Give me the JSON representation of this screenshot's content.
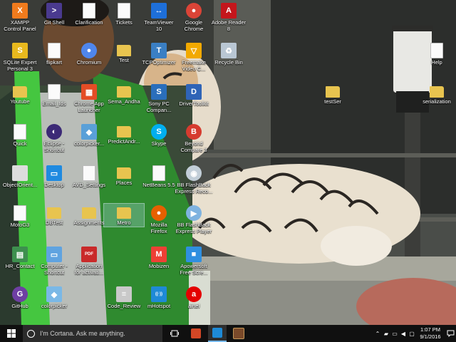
{
  "desktop": {
    "icons": [
      {
        "label": "XAMPP\nControl Panel",
        "icon": "xampp-icon",
        "color": "#f07b1d",
        "glyph": "X",
        "kind": "glyph"
      },
      {
        "label": "Git Shell",
        "icon": "git-shell-icon",
        "color": "#4a3a8f",
        "glyph": ">",
        "kind": "glyph"
      },
      {
        "label": "Clarification",
        "icon": "document-icon",
        "kind": "doc"
      },
      {
        "label": "Tickets",
        "icon": "document-icon",
        "kind": "doc"
      },
      {
        "label": "TeamViewer\n10",
        "icon": "teamviewer-icon",
        "color": "#1e6fd9",
        "glyph": "↔",
        "kind": "glyph"
      },
      {
        "label": "Google\nChrome",
        "icon": "chrome-icon",
        "color": "#db4437",
        "glyph": "●",
        "kind": "round"
      },
      {
        "label": "Adobe Reader\n8",
        "icon": "adobe-reader-icon",
        "color": "#c4161c",
        "glyph": "A",
        "kind": "glyph"
      },
      {
        "label": "SQLite Expert\nPersonal 3",
        "icon": "sqlite-icon",
        "color": "#e8b91e",
        "glyph": "S",
        "kind": "glyph"
      },
      {
        "label": "flipkart",
        "icon": "document-icon",
        "kind": "doc"
      },
      {
        "label": "Chromium",
        "icon": "chromium-icon",
        "color": "#4f86ec",
        "glyph": "●",
        "kind": "round"
      },
      {
        "label": "Test",
        "icon": "folder-icon",
        "kind": "folder"
      },
      {
        "label": "TCPOptimizer",
        "icon": "tcpoptimizer-icon",
        "color": "#3a7fc4",
        "glyph": "T",
        "kind": "glyph"
      },
      {
        "label": "Freemake\nVideo C...",
        "icon": "freemake-icon",
        "color": "#f2a900",
        "glyph": "▽",
        "kind": "glyph"
      },
      {
        "label": "Recycle Bin",
        "icon": "recycle-bin-icon",
        "color": "#b9c7d4",
        "glyph": "♻",
        "kind": "glyph"
      },
      {
        "label": "Help",
        "icon": "document-icon",
        "kind": "doc"
      },
      {
        "label": "Youtube",
        "icon": "folder-icon",
        "kind": "folder"
      },
      {
        "label": "Email_Ids",
        "icon": "document-icon",
        "kind": "doc"
      },
      {
        "label": "Chrome App\nLauncher",
        "icon": "chrome-app-launcher-icon",
        "color": "#e44d26",
        "glyph": "▦",
        "kind": "glyph"
      },
      {
        "label": "Sema_Andha",
        "icon": "folder-icon",
        "kind": "folder"
      },
      {
        "label": "Sony PC\nCompan...",
        "icon": "sony-pc-companion-icon",
        "color": "#2a6ebb",
        "glyph": "S",
        "kind": "glyph"
      },
      {
        "label": "DriverToolkit",
        "icon": "drivertoolkit-icon",
        "color": "#2f64b7",
        "glyph": "D",
        "kind": "glyph"
      },
      {
        "label": "testSer",
        "icon": "folder-icon",
        "kind": "folder"
      },
      {
        "label": "serialization",
        "icon": "folder-icon",
        "kind": "folder"
      },
      {
        "label": "Quick",
        "icon": "document-icon",
        "kind": "doc"
      },
      {
        "label": "Eclipse -\nShortcut",
        "icon": "eclipse-icon",
        "color": "#3c2a76",
        "glyph": "◐",
        "kind": "round"
      },
      {
        "label": "colorpicker...",
        "icon": "colorpicker-icon",
        "color": "#5aa0d8",
        "glyph": "◆",
        "kind": "glyph"
      },
      {
        "label": "PredictAndr...",
        "icon": "folder-icon",
        "kind": "folder"
      },
      {
        "label": "Skype",
        "icon": "skype-icon",
        "color": "#00aff0",
        "glyph": "S",
        "kind": "round"
      },
      {
        "label": "Beyond\nCompare 3",
        "icon": "beyond-compare-icon",
        "color": "#d63b2f",
        "glyph": "B",
        "kind": "round"
      },
      {
        "label": "ObjectOrient...",
        "icon": "object-orient-icon",
        "color": "#dcdcdc",
        "glyph": "",
        "kind": "glyph"
      },
      {
        "label": "Desktop",
        "icon": "desktop-shortcut-icon",
        "color": "#1f8ae0",
        "glyph": "▭",
        "kind": "glyph"
      },
      {
        "label": "AVD_Settings",
        "icon": "document-icon",
        "kind": "doc"
      },
      {
        "label": "Places",
        "icon": "folder-icon",
        "kind": "folder"
      },
      {
        "label": "NetBeans 5.5",
        "icon": "document-icon",
        "kind": "doc"
      },
      {
        "label": "BB FlashBack\nExpress Reco...",
        "icon": "bb-flashback-recorder-icon",
        "color": "#c2ced8",
        "glyph": "◉",
        "kind": "round"
      },
      {
        "label": "MotoG3",
        "icon": "document-icon",
        "kind": "doc"
      },
      {
        "label": "DBTest",
        "icon": "folder-icon",
        "kind": "folder"
      },
      {
        "label": "Assignments",
        "icon": "folder-icon",
        "kind": "folder"
      },
      {
        "label": "Metro",
        "icon": "folder-icon",
        "kind": "folder"
      },
      {
        "label": "Mozilla\nFirefox",
        "icon": "firefox-icon",
        "color": "#e66000",
        "glyph": "●",
        "kind": "round"
      },
      {
        "label": "BB FlashBack\nExpress Player",
        "icon": "bb-flashback-player-icon",
        "color": "#7fb3e0",
        "glyph": "▶",
        "kind": "round"
      },
      {
        "label": "HR_Contact",
        "icon": "spreadsheet-icon",
        "color": "#3d8f4e",
        "glyph": "▤",
        "kind": "glyph"
      },
      {
        "label": "Computer -\nShortcut",
        "icon": "computer-icon",
        "color": "#5fa3e0",
        "glyph": "▭",
        "kind": "glyph"
      },
      {
        "label": "Application\nfor activati...",
        "icon": "pdf-icon",
        "color": "#c92a2a",
        "glyph": "PDF",
        "kind": "glyph"
      },
      {
        "label": "Mobizen",
        "icon": "mobizen-icon",
        "color": "#ee4035",
        "glyph": "M",
        "kind": "glyph"
      },
      {
        "label": "Apowersoft\nFree Scre...",
        "icon": "apowersoft-icon",
        "color": "#2f8fe0",
        "glyph": "■",
        "kind": "glyph"
      },
      {
        "label": "GitHub",
        "icon": "github-icon",
        "color": "#6e3fa3",
        "glyph": "G",
        "kind": "round"
      },
      {
        "label": "colorpicker",
        "icon": "colorpicker-icon",
        "color": "#7ab8e6",
        "glyph": "◆",
        "kind": "glyph"
      },
      {
        "label": "Code_Review",
        "icon": "code-review-icon",
        "color": "#c9c9c9",
        "glyph": "≡",
        "kind": "glyph"
      },
      {
        "label": "mHotspot",
        "icon": "mhotspot-icon",
        "color": "#1e8ad6",
        "glyph": "((·))",
        "kind": "glyph"
      },
      {
        "label": "airtel",
        "icon": "airtel-icon",
        "color": "#e40000",
        "glyph": "a",
        "kind": "round"
      }
    ]
  },
  "taskbar": {
    "search_placeholder": "I'm Cortana. Ask me anything.",
    "clock_time": "1:07 PM",
    "clock_date": "9/1/2016",
    "pinned": [
      {
        "icon": "task-view-icon"
      },
      {
        "icon": "powerpoint-icon",
        "color": "#d24726"
      },
      {
        "icon": "mhotspot-taskbar-icon",
        "color": "#1e8ad6"
      },
      {
        "icon": "game-app-icon",
        "color": "#7a4a2a"
      }
    ]
  }
}
